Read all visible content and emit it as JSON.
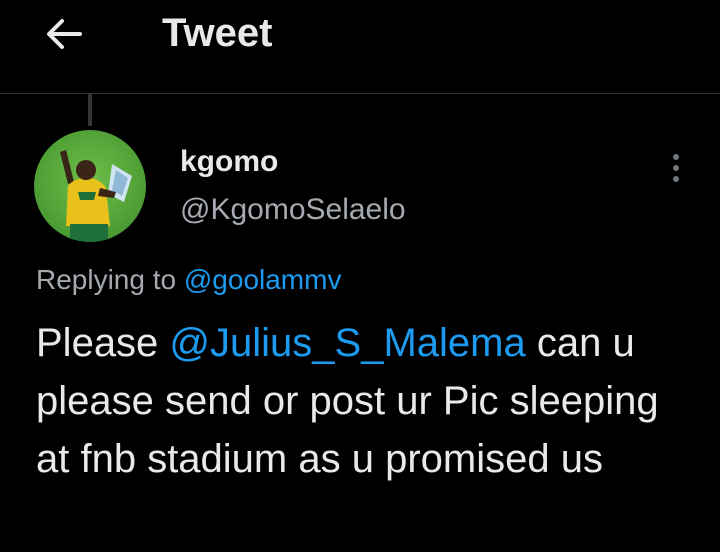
{
  "header": {
    "back_icon": "arrow-left-icon",
    "title": "Tweet"
  },
  "tweet": {
    "author": {
      "display_name": "kgomo",
      "handle": "@KgomoSelaelo",
      "avatar_icon": "profile-photo"
    },
    "more_icon": "more-vertical-icon",
    "replying_to_label": "Replying to",
    "replying_to_handle": "@goolammv",
    "text_before_mention": "Please ",
    "mention": "@Julius_S_Malema",
    "text_after_mention": " can u please send or post ur Pic sleeping at fnb stadium as u promised us"
  },
  "colors": {
    "background": "#000000",
    "text": "#e7e9ea",
    "secondary": "#a5aab0",
    "link": "#1d9bf0",
    "divider": "#2f3336"
  }
}
